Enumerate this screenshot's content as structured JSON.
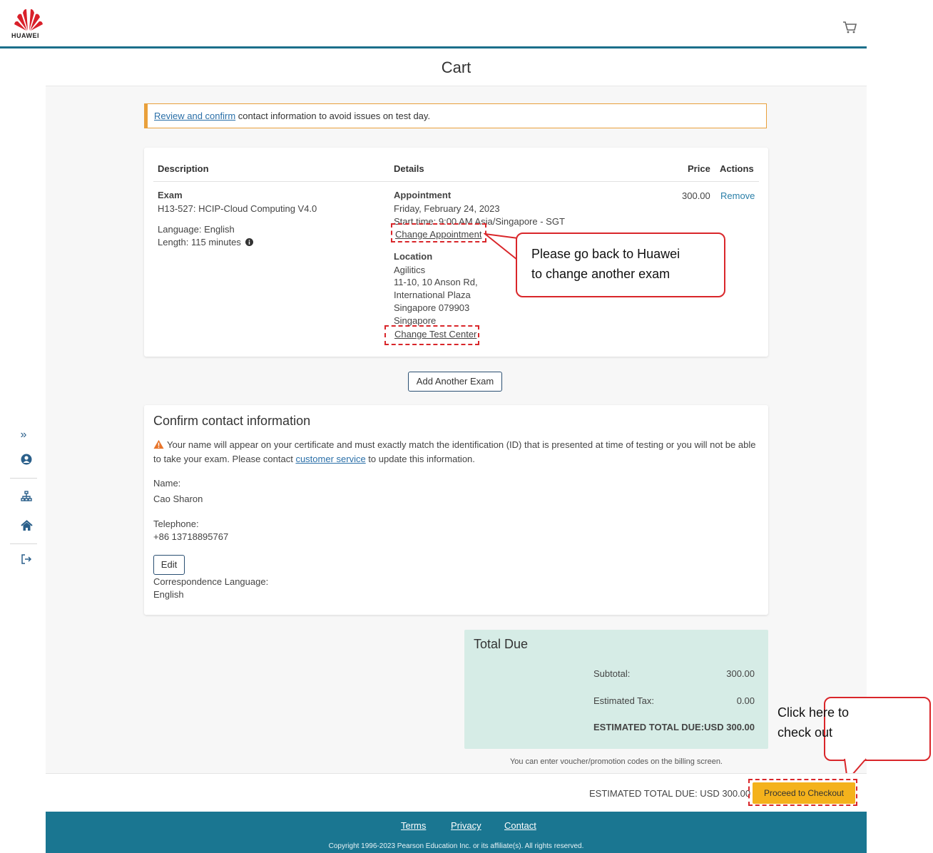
{
  "header": {
    "brand": "HUAWEI",
    "cart_icon": "cart-icon"
  },
  "page": {
    "title": "Cart"
  },
  "sidebar": {
    "icons": [
      "expand-icon",
      "user-icon",
      "sitemap-icon",
      "home-icon",
      "logout-icon"
    ]
  },
  "alert": {
    "link": "Review and confirm",
    "text": " contact information to avoid issues on test day."
  },
  "cart_table": {
    "headers": {
      "description": "Description",
      "details": "Details",
      "price": "Price",
      "actions": "Actions"
    },
    "item": {
      "type": "Exam",
      "name": "H13-527: HCIP-Cloud Computing V4.0",
      "language": "Language: English",
      "length": "Length: 115 minutes",
      "appointment_heading": "Appointment",
      "date": "Friday, February 24, 2023",
      "start_time": "Start time: 9:00 AM Asia/Singapore - SGT",
      "change_appointment": "Change Appointment",
      "location_heading": "Location",
      "location_lines": [
        "Agilitics",
        "11-10, 10 Anson Rd,",
        "International Plaza",
        "Singapore 079903",
        "Singapore"
      ],
      "change_test_center": "Change Test Center",
      "price": "300.00",
      "remove": "Remove"
    }
  },
  "annotation_appointment": {
    "line1": "Please go back to Huawei",
    "line2": "to change another exam"
  },
  "add_exam": "Add Another Exam",
  "contact": {
    "title": "Confirm contact information",
    "warning_pre": "Your name will appear on your certificate and must exactly match the identification (ID) that is presented at time of testing or you will not be able to take your exam. Please contact ",
    "warning_link": "customer service",
    "warning_post": " to update this information.",
    "name_label": "Name:",
    "name_value": "Cao Sharon",
    "phone_label": "Telephone:",
    "phone_value": "+86 13718895767",
    "edit": "Edit",
    "lang_label": "Correspondence Language:",
    "lang_value": "English"
  },
  "totals": {
    "title": "Total Due",
    "subtotal_label": "Subtotal:",
    "subtotal_value": "300.00",
    "tax_label": "Estimated Tax:",
    "tax_value": "0.00",
    "total_label": "ESTIMATED TOTAL DUE:",
    "total_value": "USD 300.00",
    "voucher_note": "You can enter voucher/promotion codes on the billing screen."
  },
  "bottom_bar": {
    "total_text": "ESTIMATED TOTAL DUE: USD 300.00",
    "checkout": "Proceed to Checkout"
  },
  "annotation_checkout": {
    "line1": "Click here to",
    "line2": "check out"
  },
  "footer": {
    "terms": "Terms",
    "privacy": "Privacy",
    "contact": "Contact",
    "copyright": "Copyright 1996-2023 Pearson Education Inc. or its affiliate(s). All rights reserved."
  },
  "colors": {
    "accent_teal": "#1a7691",
    "checkout_yellow": "#f4b21c",
    "annotation_red": "#d9262a",
    "total_bg": "#d6ece6"
  }
}
